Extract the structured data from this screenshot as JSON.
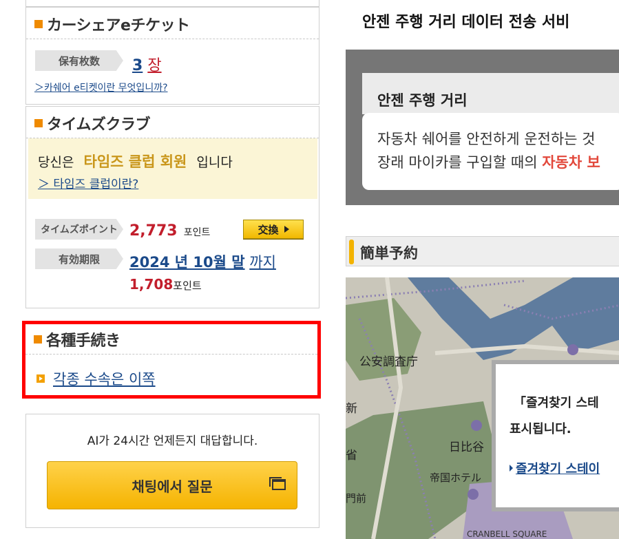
{
  "left": {
    "carshare": {
      "title": "カーシェアeチケット",
      "held_label": "保有枚数",
      "held_count": "3",
      "held_unit": "장",
      "about_link": "＞카쉐어 e티켓이란 무엇입니까?"
    },
    "times_club": {
      "title": "タイムズクラブ",
      "member_prefix": "당신은",
      "member_rank": "타임즈 클럽 회원",
      "member_suffix": "입니다",
      "about_link": "＞ 타임즈 클럽이란?",
      "points_label": "タイムズポイント",
      "points_value": "2,773",
      "points_unit": "포인트",
      "exchange_button": "交換",
      "expiry_label": "有効期限",
      "expiry_date": "2024 년 10월 말",
      "expiry_suffix": "까지",
      "expiring_points": "1,708",
      "expiring_unit": "포인트"
    },
    "procedures": {
      "title": "各種手続き",
      "link": "각종 수속은 이쪽"
    },
    "chat": {
      "caption": "AI가 24시간 언제든지 대답합니다.",
      "button": "채팅에서 질문"
    },
    "colors": {
      "accent_orange": "#ef8a00",
      "highlight_red": "#ff0000",
      "value_red": "#c21e2c",
      "member_gold": "#c9961a"
    }
  },
  "right": {
    "service_title": "안젠 주행 거리 데이터 전송 서비",
    "panel": {
      "heading": "안젠 주행 거리",
      "line1": "자동차 쉐어를 안전하게 운전하는 것",
      "line2_prefix": "장래 마이카를 구입할 때의",
      "line2_highlight": "자동차 보"
    },
    "quick_reserve": {
      "title": "簡単予約"
    },
    "map": {
      "labels": [
        "公安調査庁",
        "日比谷",
        "帝国ホテル",
        "省",
        "門前",
        "新",
        "CRANBELL SQUARE"
      ],
      "popup": {
        "line1": "「즐겨찾기 스테",
        "line2": "표시됩니다.",
        "link": "즐겨찾기 스테이"
      }
    }
  }
}
